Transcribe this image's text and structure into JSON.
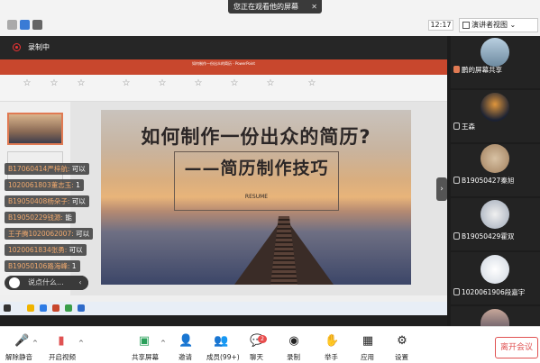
{
  "viewing_banner": "您正在观看他的屏幕",
  "clock": "12:17",
  "speaker_view_label": "演讲者视图",
  "recording_label": "录制中",
  "ppt": {
    "window_title": "如何制作一份出众的简历 - PowerPoint",
    "slide_title": "如何制作一份出众的简历?",
    "slide_subtitle": "——简历制作技巧",
    "slide_small": "RESUME"
  },
  "chat_messages": [
    {
      "name": "B17060414严梓航:",
      "text": "可以"
    },
    {
      "name": "1020061803董志玉:",
      "text": "1"
    },
    {
      "name": "B19050408杨朵子:",
      "text": "可以"
    },
    {
      "name": "B19050229钱源:",
      "text": "能"
    },
    {
      "name": "王子腾1020062007:",
      "text": "可以"
    },
    {
      "name": "1020061834张勇:",
      "text": "可以"
    },
    {
      "name": "B19050106路海峰:",
      "text": "1"
    }
  ],
  "chat_input_placeholder": "说点什么...",
  "participants": [
    {
      "name": "鹏的屏幕共享"
    },
    {
      "name": "王森"
    },
    {
      "name": "B19050427秦旭"
    },
    {
      "name": "B19050429霍双"
    },
    {
      "name": "1020061906段嘉宇"
    }
  ],
  "toolbar": {
    "mute": "解除静音",
    "video": "开启视频",
    "share": "共享屏幕",
    "invite": "邀请",
    "members": "成员(99+)",
    "chat": "聊天",
    "chat_badge": "2",
    "record": "录制",
    "raise": "举手",
    "apps": "应用",
    "settings": "设置",
    "leave": "离开会议"
  },
  "colors": {
    "accent_red": "#e05252",
    "ppt_red": "#c8472d",
    "chat_name": "#f0a96e"
  }
}
